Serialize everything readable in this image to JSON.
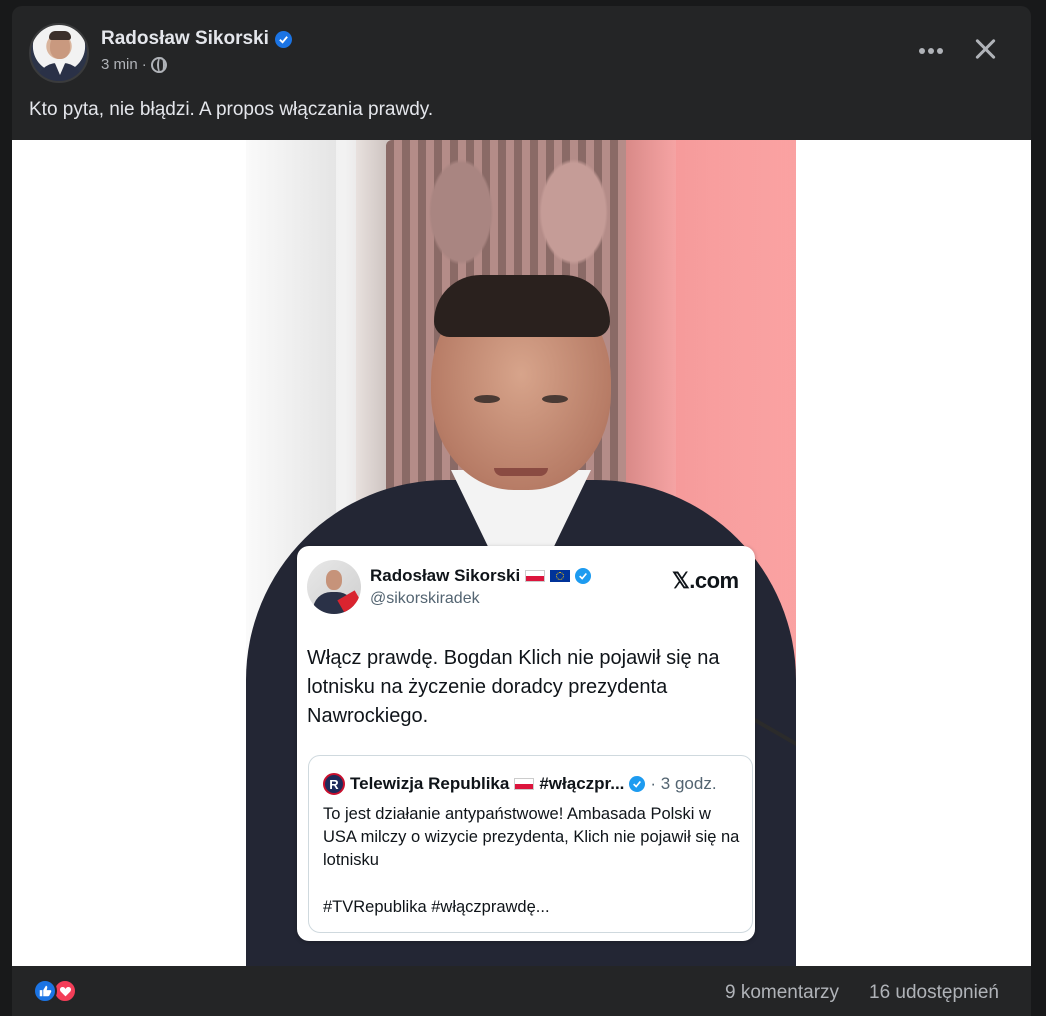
{
  "post": {
    "author": "Radosław Sikorski",
    "time": "3 min",
    "separator": "·",
    "caption": "Kto pyta, nie błądzi. A propos włączania prawdy.",
    "icons": [
      "verified-badge-icon",
      "globe-icon",
      "more-options-icon",
      "close-icon"
    ]
  },
  "embedded_tweet": {
    "author": "Radosław Sikorski",
    "handle": "@sikorskiradek",
    "site": "𝕏.com",
    "text": "Włącz prawdę. Bogdan Klich nie pojawił się na lotnisku na życzenie doradcy prezydenta Nawrockiego.",
    "quote": {
      "logo_letter": "R",
      "author": "Telewizja Republika",
      "hashtag_title": "#włączpr...",
      "time": "· 3 godz.",
      "text": "To jest działanie antypaństwowe! Ambasada Polski w USA milczy o wizycie prezydenta, Klich nie pojawił się na lotnisku",
      "tags": "#TVRepublika #włączprawdę..."
    }
  },
  "footer": {
    "reactions": [
      "like",
      "love"
    ],
    "comments": "9 komentarzy",
    "shares": "16 udostępnień"
  },
  "colors": {
    "background": "#242526",
    "text_primary": "#e4e6eb",
    "text_secondary": "#b0b3b8",
    "verified": "#1b74e4",
    "love": "#f33e58"
  }
}
